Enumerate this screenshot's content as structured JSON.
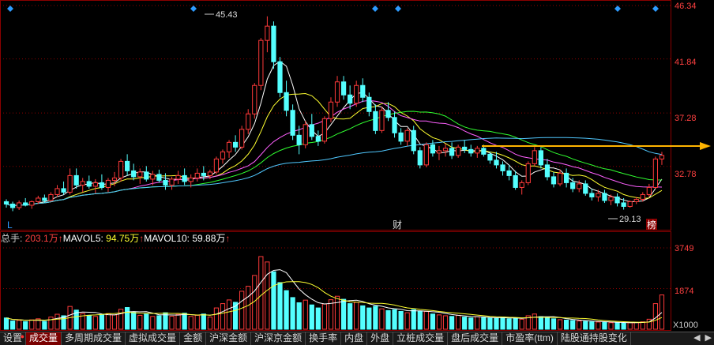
{
  "price_panel": {
    "y_ticks": [
      "46.34",
      "41.84",
      "37.28",
      "32.78"
    ],
    "max_label": "45.43",
    "min_label": "29.13",
    "marker_L": "L",
    "marker_cai": "财",
    "marker_bang": "榜"
  },
  "volume_panel": {
    "legend_total_label": "总手: ",
    "legend_total_value": "203.1万",
    "legend_ma5_label": "MAVOL5: ",
    "legend_ma5_value": "94.75万",
    "legend_ma10_label": "MAVOL10: ",
    "legend_ma10_value": "59.88万",
    "up_arrow": "↑",
    "y_ticks": [
      "3749",
      "1874"
    ],
    "unit": "X1000"
  },
  "tabs": [
    {
      "label": "设置",
      "dot": true
    },
    {
      "label": "成交量",
      "active": true
    },
    {
      "label": "多周期成交量"
    },
    {
      "label": "虚拟成交量"
    },
    {
      "label": "金额"
    },
    {
      "label": "沪深金额"
    },
    {
      "label": "沪深京金额"
    },
    {
      "label": "换手率"
    },
    {
      "label": "内盘"
    },
    {
      "label": "外盘"
    },
    {
      "label": "立桩成交量"
    },
    {
      "label": "盘后成交量"
    },
    {
      "label": "市盈率(ttm)"
    },
    {
      "label": "陆股通持股变化"
    }
  ],
  "arrows": {
    "left": "◀",
    "right": "▶"
  },
  "colors": {
    "up": "#ff3a3a",
    "down": "#54ffff",
    "ma5": "#ffffff",
    "ma10": "#ffff30",
    "ma20": "#ff60ff",
    "ma30": "#30ff30",
    "ma60": "#50c8ff",
    "arrow": "#ffb400",
    "diamond": "#2d9bff",
    "grid": "#8b0000"
  },
  "chart_data": {
    "type": "candlestick",
    "ylim": [
      27.5,
      46.34
    ],
    "candles": [
      [
        29.8,
        30.0,
        29.3,
        29.6
      ],
      [
        29.6,
        29.8,
        29.0,
        29.3
      ],
      [
        29.3,
        29.9,
        29.1,
        29.7
      ],
      [
        29.7,
        30.1,
        29.4,
        29.5
      ],
      [
        29.5,
        29.9,
        29.2,
        29.8
      ],
      [
        29.8,
        30.3,
        29.6,
        30.1
      ],
      [
        30.1,
        30.4,
        29.7,
        29.9
      ],
      [
        29.9,
        30.6,
        29.8,
        30.4
      ],
      [
        30.4,
        31.2,
        30.2,
        30.9
      ],
      [
        30.9,
        31.5,
        30.4,
        30.6
      ],
      [
        30.6,
        32.6,
        30.4,
        32.0
      ],
      [
        32.0,
        32.6,
        30.9,
        31.2
      ],
      [
        31.2,
        31.8,
        30.6,
        31.5
      ],
      [
        31.5,
        32.0,
        30.9,
        31.1
      ],
      [
        31.1,
        31.7,
        30.5,
        31.4
      ],
      [
        31.4,
        32.1,
        30.8,
        31.0
      ],
      [
        31.0,
        31.8,
        30.6,
        31.6
      ],
      [
        31.6,
        32.3,
        31.1,
        31.8
      ],
      [
        31.8,
        33.4,
        31.5,
        33.2
      ],
      [
        33.2,
        33.8,
        32.0,
        32.4
      ],
      [
        32.4,
        33.0,
        31.6,
        31.9
      ],
      [
        31.9,
        32.6,
        31.3,
        32.3
      ],
      [
        32.3,
        32.8,
        31.5,
        31.7
      ],
      [
        31.7,
        32.4,
        31.2,
        32.1
      ],
      [
        32.1,
        32.5,
        31.4,
        31.6
      ],
      [
        31.6,
        32.2,
        30.8,
        31.2
      ],
      [
        31.2,
        31.9,
        30.8,
        31.7
      ],
      [
        31.7,
        32.4,
        31.3,
        32.0
      ],
      [
        32.0,
        32.6,
        31.2,
        31.5
      ],
      [
        31.5,
        32.1,
        31.0,
        31.8
      ],
      [
        31.8,
        32.6,
        31.5,
        32.2
      ],
      [
        32.2,
        32.8,
        31.6,
        32.0
      ],
      [
        32.0,
        32.5,
        31.7,
        32.3
      ],
      [
        32.3,
        33.6,
        32.1,
        33.4
      ],
      [
        33.4,
        34.2,
        33.0,
        34.0
      ],
      [
        34.0,
        35.0,
        33.5,
        34.8
      ],
      [
        34.8,
        35.4,
        34.0,
        34.4
      ],
      [
        34.4,
        36.2,
        34.2,
        35.9
      ],
      [
        35.9,
        37.6,
        35.5,
        37.2
      ],
      [
        37.2,
        39.8,
        36.8,
        39.6
      ],
      [
        39.6,
        43.6,
        39.2,
        43.4
      ],
      [
        43.4,
        45.43,
        42.4,
        44.6
      ],
      [
        44.6,
        45.0,
        41.0,
        41.6
      ],
      [
        41.6,
        42.0,
        38.6,
        39.0
      ],
      [
        39.0,
        40.0,
        37.0,
        37.5
      ],
      [
        37.5,
        38.0,
        35.0,
        35.4
      ],
      [
        35.4,
        36.2,
        33.8,
        34.6
      ],
      [
        34.6,
        36.6,
        34.3,
        36.3
      ],
      [
        36.3,
        37.2,
        35.0,
        35.3
      ],
      [
        35.3,
        35.8,
        34.5,
        34.9
      ],
      [
        34.9,
        37.0,
        34.7,
        36.8
      ],
      [
        36.8,
        38.6,
        36.5,
        38.2
      ],
      [
        38.2,
        40.4,
        37.8,
        39.9
      ],
      [
        39.9,
        40.4,
        38.4,
        38.8
      ],
      [
        38.8,
        39.6,
        37.6,
        38.1
      ],
      [
        38.1,
        40.0,
        37.8,
        39.6
      ],
      [
        39.6,
        40.2,
        38.2,
        38.6
      ],
      [
        38.6,
        39.0,
        37.0,
        37.4
      ],
      [
        37.4,
        38.0,
        35.5,
        35.8
      ],
      [
        35.8,
        37.8,
        35.6,
        37.5
      ],
      [
        37.5,
        38.2,
        36.6,
        36.9
      ],
      [
        36.9,
        37.4,
        35.2,
        35.6
      ],
      [
        35.6,
        36.0,
        34.6,
        34.9
      ],
      [
        34.9,
        36.0,
        34.5,
        35.8
      ],
      [
        35.8,
        36.2,
        33.8,
        34.1
      ],
      [
        34.1,
        34.4,
        32.6,
        32.9
      ],
      [
        32.9,
        34.8,
        32.7,
        34.6
      ],
      [
        34.6,
        35.0,
        33.6,
        33.9
      ],
      [
        33.9,
        34.5,
        33.3,
        34.1
      ],
      [
        34.1,
        34.7,
        33.6,
        34.3
      ],
      [
        34.3,
        34.8,
        33.4,
        33.7
      ],
      [
        33.7,
        34.6,
        33.5,
        34.4
      ],
      [
        34.4,
        35.0,
        33.9,
        34.2
      ],
      [
        34.2,
        34.6,
        33.6,
        33.9
      ],
      [
        33.9,
        34.5,
        33.5,
        34.3
      ],
      [
        34.3,
        34.6,
        33.6,
        33.8
      ],
      [
        33.8,
        34.0,
        33.0,
        33.3
      ],
      [
        33.3,
        34.0,
        32.6,
        32.9
      ],
      [
        32.9,
        33.2,
        32.0,
        32.4
      ],
      [
        32.4,
        32.9,
        31.6,
        32.0
      ],
      [
        32.0,
        32.4,
        30.8,
        31.0
      ],
      [
        31.0,
        31.6,
        30.4,
        31.4
      ],
      [
        31.4,
        33.2,
        31.2,
        33.0
      ],
      [
        33.0,
        34.4,
        32.8,
        34.1
      ],
      [
        34.1,
        34.4,
        32.6,
        32.9
      ],
      [
        32.9,
        33.4,
        31.6,
        31.9
      ],
      [
        31.9,
        32.3,
        31.0,
        31.3
      ],
      [
        31.3,
        32.5,
        31.1,
        32.2
      ],
      [
        32.2,
        32.6,
        31.0,
        31.4
      ],
      [
        31.4,
        31.8,
        30.6,
        30.9
      ],
      [
        30.9,
        31.6,
        30.6,
        31.3
      ],
      [
        31.3,
        31.6,
        30.3,
        30.5
      ],
      [
        30.5,
        30.9,
        29.9,
        30.2
      ],
      [
        30.2,
        30.8,
        29.8,
        30.5
      ],
      [
        30.5,
        30.8,
        29.7,
        29.9
      ],
      [
        29.9,
        30.4,
        29.5,
        30.2
      ],
      [
        30.2,
        30.5,
        29.4,
        29.7
      ],
      [
        29.7,
        30.1,
        29.13,
        29.4
      ],
      [
        29.4,
        29.9,
        29.3,
        29.8
      ],
      [
        29.8,
        30.2,
        29.6,
        30.0
      ],
      [
        30.0,
        30.6,
        29.8,
        30.4
      ],
      [
        30.4,
        31.3,
        30.2,
        31.0
      ],
      [
        31.0,
        33.6,
        30.9,
        33.4
      ],
      [
        33.4,
        34.0,
        32.9,
        33.7
      ]
    ],
    "volumes": [
      520,
      380,
      410,
      350,
      430,
      480,
      360,
      560,
      690,
      620,
      1050,
      880,
      720,
      640,
      590,
      680,
      720,
      660,
      920,
      1000,
      780,
      640,
      700,
      590,
      620,
      760,
      600,
      680,
      740,
      590,
      640,
      700,
      560,
      980,
      1180,
      1350,
      1240,
      1750,
      1980,
      2480,
      3349,
      3100,
      2650,
      2150,
      1780,
      1460,
      1220,
      1340,
      1120,
      980,
      1160,
      1360,
      1520,
      1380,
      1180,
      1240,
      1080,
      980,
      1060,
      940,
      860,
      900,
      820,
      760,
      900,
      840,
      820,
      700,
      660,
      620,
      590,
      640,
      560,
      520,
      580,
      540,
      520,
      500,
      560,
      480,
      520,
      460,
      620,
      700,
      580,
      520,
      480,
      440,
      420,
      400,
      380,
      360,
      340,
      330,
      320,
      300,
      310,
      280,
      300,
      310,
      340,
      460,
      1180,
      1580
    ]
  }
}
